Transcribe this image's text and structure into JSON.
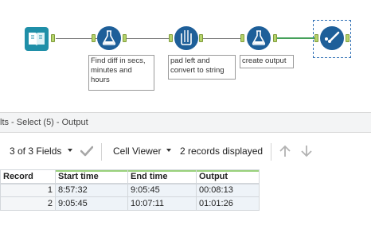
{
  "workflow": {
    "annotations": {
      "tool2": "Find diff in secs,\nminutes and\nhours",
      "tool3": "pad left and\nconvert to string",
      "tool4": "create output"
    }
  },
  "results": {
    "title": "lts - Select (5) - Output",
    "toolbar": {
      "fields_label": "3 of 3 Fields",
      "viewer_label": "Cell Viewer",
      "records_label": "2 records displayed"
    },
    "columns": [
      "Record",
      "Start time",
      "End time",
      "Output"
    ],
    "rows": [
      [
        "1",
        "8:57:32",
        "9:05:45",
        "00:08:13"
      ],
      [
        "2",
        "9:05:45",
        "10:07:11",
        "01:01:26"
      ]
    ]
  },
  "colors": {
    "tool_blue": "#1e5f99",
    "anchor_green": "#b5d36b",
    "connection_selected": "#45a05a",
    "selection_border": "#2f6fb5"
  },
  "icons": [
    "book-input-icon",
    "formula-flask-icon",
    "multi-field-formula-icon",
    "formula-flask-icon",
    "select-check-icon",
    "checkmark-icon",
    "arrow-up-icon",
    "arrow-down-icon",
    "dropdown-caret-icon"
  ]
}
